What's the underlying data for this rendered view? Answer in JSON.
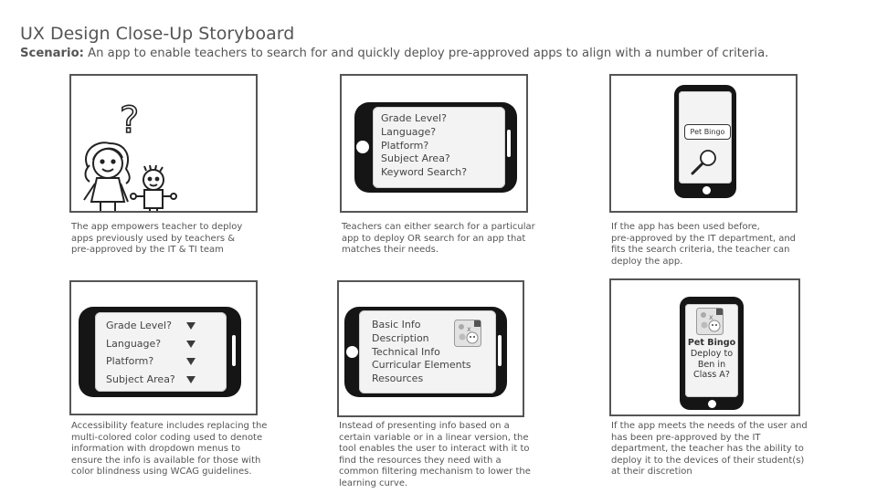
{
  "header": {
    "title": "UX Design Close-Up Storyboard",
    "scenario_label": "Scenario:",
    "scenario_text": " An app to enable teachers to search for and quickly deploy pre-approved apps to align with a number of criteria."
  },
  "panels": [
    {
      "caption_lines": [
        "The app empowers teacher to deploy",
        "apps previously used by teachers &",
        "pre-approved by the IT & TI team"
      ],
      "bubble": "?"
    },
    {
      "items": [
        "Grade Level?",
        "Language?",
        "Platform?",
        "Subject Area?",
        "Keyword Search?"
      ],
      "caption_lines": [
        "Teachers can either search for a particular",
        "app to deploy OR search for an app that",
        "matches their needs."
      ]
    },
    {
      "search_text": "Pet Bingo",
      "caption_lines": [
        "If the app has been used before,",
        "pre-approved by the IT department, and",
        "fits the search criteria, the teacher can",
        "deploy the app."
      ]
    },
    {
      "items": [
        "Grade Level?",
        "Language?",
        "Platform?",
        "Subject Area?"
      ],
      "caption_lines": [
        "Accessibility feature includes replacing the",
        "multi-colored color coding used to denote",
        "information with dropdown menus to",
        "ensure the info is available for those with",
        "color blindness using WCAG guidelines."
      ]
    },
    {
      "items": [
        "Basic Info",
        "Description",
        "Technical Info",
        "Curricular Elements",
        "Resources"
      ],
      "caption_lines": [
        "Instead of presenting info based on a",
        "certain variable or in a linear version, the",
        "tool enables the user to interact with it to",
        "find the resources they need with a",
        "common filtering mechanism to lower the",
        "learning curve."
      ]
    },
    {
      "app_name": "Pet Bingo",
      "prompt_lines": [
        "Deploy to",
        "Ben in",
        "Class A?"
      ],
      "caption_lines": [
        "If the app meets the needs of the user and",
        "has been pre-approved by the IT",
        "department, the teacher has the ability to",
        "deploy it to the devices of their student(s)",
        "at their discretion"
      ]
    }
  ]
}
